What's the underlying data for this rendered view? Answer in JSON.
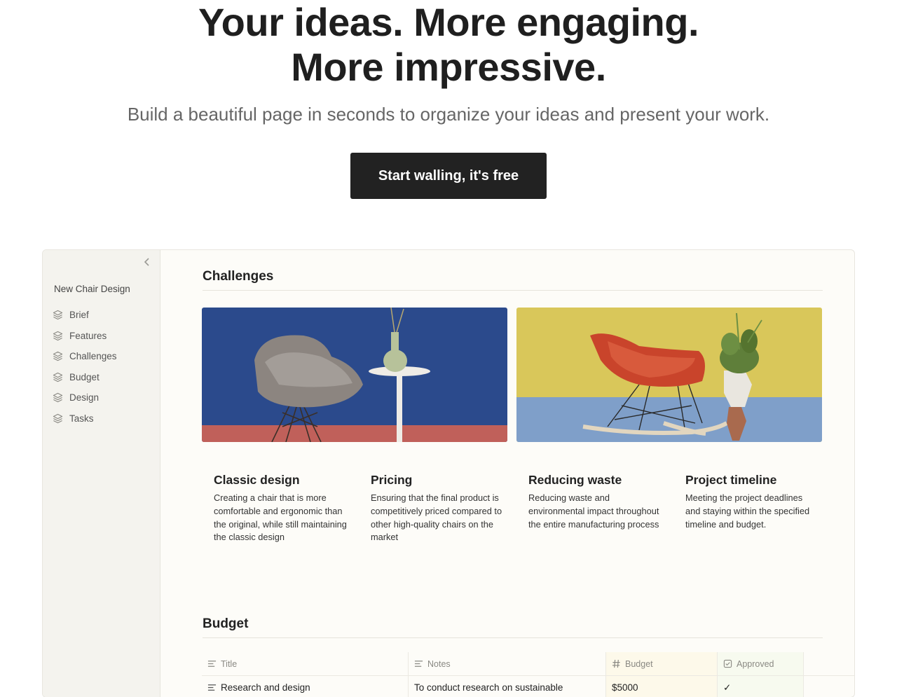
{
  "hero": {
    "title_line1": "Your ideas. More engaging.",
    "title_line2": "More impressive.",
    "subtitle": "Build a beautiful page in seconds to organize your ideas and present your work.",
    "cta_label": "Start walling, it's free"
  },
  "sidebar": {
    "collapse_icon": "chevron-left-icon",
    "workspace_title": "New Chair Design",
    "items": [
      {
        "label": "Brief",
        "icon": "layers-icon"
      },
      {
        "label": "Features",
        "icon": "layers-icon"
      },
      {
        "label": "Challenges",
        "icon": "layers-icon"
      },
      {
        "label": "Budget",
        "icon": "layers-icon"
      },
      {
        "label": "Design",
        "icon": "layers-icon"
      },
      {
        "label": "Tasks",
        "icon": "layers-icon"
      }
    ]
  },
  "challenges": {
    "heading": "Challenges",
    "cards": [
      {
        "title": "Classic design",
        "text": "Creating a chair that is more comfortable and ergonomic than the original, while still maintaining the classic design"
      },
      {
        "title": "Pricing",
        "text": "Ensuring that the final product is competitively priced compared to other high-quality chairs on the market"
      },
      {
        "title": "Reducing waste",
        "text": "Reducing waste and environmental impact throughout the entire manufacturing process"
      },
      {
        "title": "Project timeline",
        "text": "Meeting the project deadlines and staying within the specified timeline and budget."
      }
    ]
  },
  "budget": {
    "heading": "Budget",
    "columns": [
      "Title",
      "Notes",
      "Budget",
      "Approved"
    ],
    "rows": [
      {
        "title": "Research and design",
        "notes": "To conduct research on sustainable",
        "budget": "$5000",
        "approved": "✓"
      }
    ]
  },
  "colors": {
    "cta_bg": "#222222",
    "panel_bg": "#fdfcf8",
    "sidebar_bg": "#f4f3ee",
    "image1_wall": "#2b4a8c",
    "image2_wall": "#d9c75a"
  }
}
